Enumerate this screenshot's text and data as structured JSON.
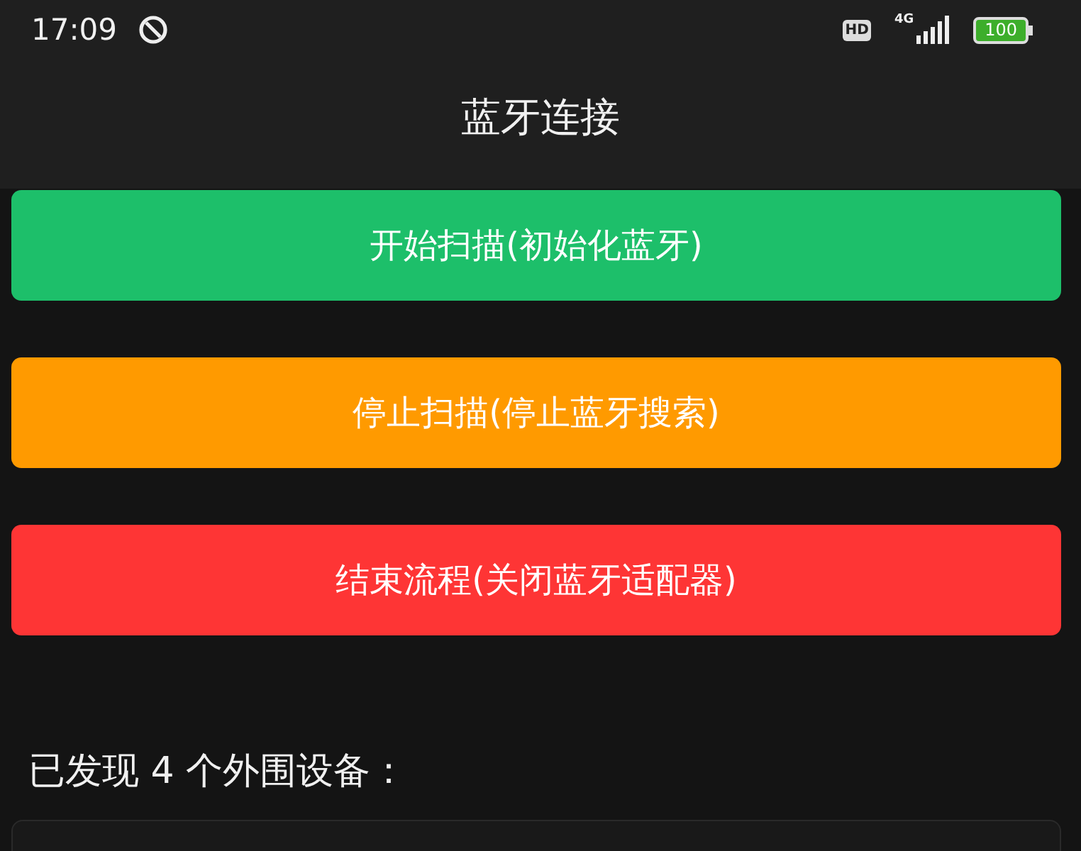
{
  "status_bar": {
    "time": "17:09",
    "hd": "HD",
    "network": "4G",
    "battery": "100"
  },
  "header": {
    "title": "蓝牙连接"
  },
  "buttons": [
    {
      "label": "开始扫描(初始化蓝牙)",
      "color": "#1dbf6a"
    },
    {
      "label": "停止扫描(停止蓝牙搜索)",
      "color": "#ff9a00"
    },
    {
      "label": "结束流程(关闭蓝牙适配器)",
      "color": "#fe3535"
    }
  ],
  "devices_heading": "已发现 4 个外围设备："
}
